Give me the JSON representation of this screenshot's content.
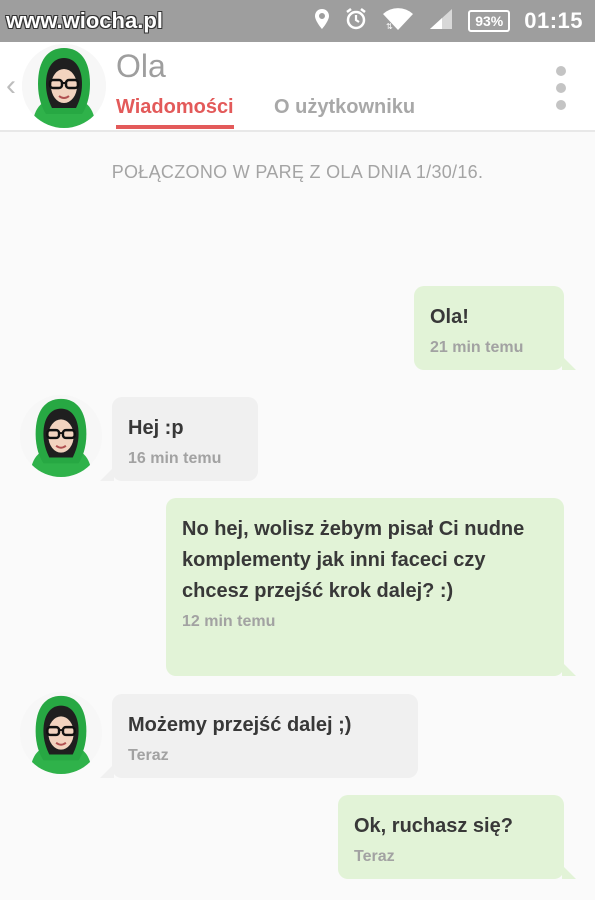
{
  "statusbar": {
    "watermark": "www.wiocha.pl",
    "battery": "93%",
    "time": "01:15",
    "icons": [
      "location-icon",
      "alarm-icon",
      "wifi-icon",
      "signal-icon"
    ]
  },
  "header": {
    "back_icon": "chevron-left-icon",
    "contact_name": "Ola",
    "tabs": [
      {
        "label": "Wiadomości",
        "active": true
      },
      {
        "label": "O użytkowniku",
        "active": false
      }
    ],
    "menu_icon": "more-vertical-icon"
  },
  "matched_text": "POŁĄCZONO W PARĘ Z OLA DNIA 1/30/16.",
  "messages": [
    {
      "direction": "out",
      "text": "Ola!",
      "time": "21 min temu"
    },
    {
      "direction": "in",
      "text": "Hej :p",
      "time": "16 min temu"
    },
    {
      "direction": "out",
      "text": "No hej, wolisz żebym pisał Ci nudne komplementy jak inni faceci czy chcesz przejść krok dalej?  :)",
      "time": "12 min temu"
    },
    {
      "direction": "in",
      "text": "Możemy przejść dalej ;)",
      "time": "Teraz"
    },
    {
      "direction": "out",
      "text": "Ok, ruchasz się?",
      "time": "Teraz"
    }
  ],
  "colors": {
    "accent": "#e35a5a",
    "outgoing_bubble": "#e2f3d7",
    "incoming_bubble": "#f0f0f0",
    "statusbar": "#9e9e9e"
  }
}
